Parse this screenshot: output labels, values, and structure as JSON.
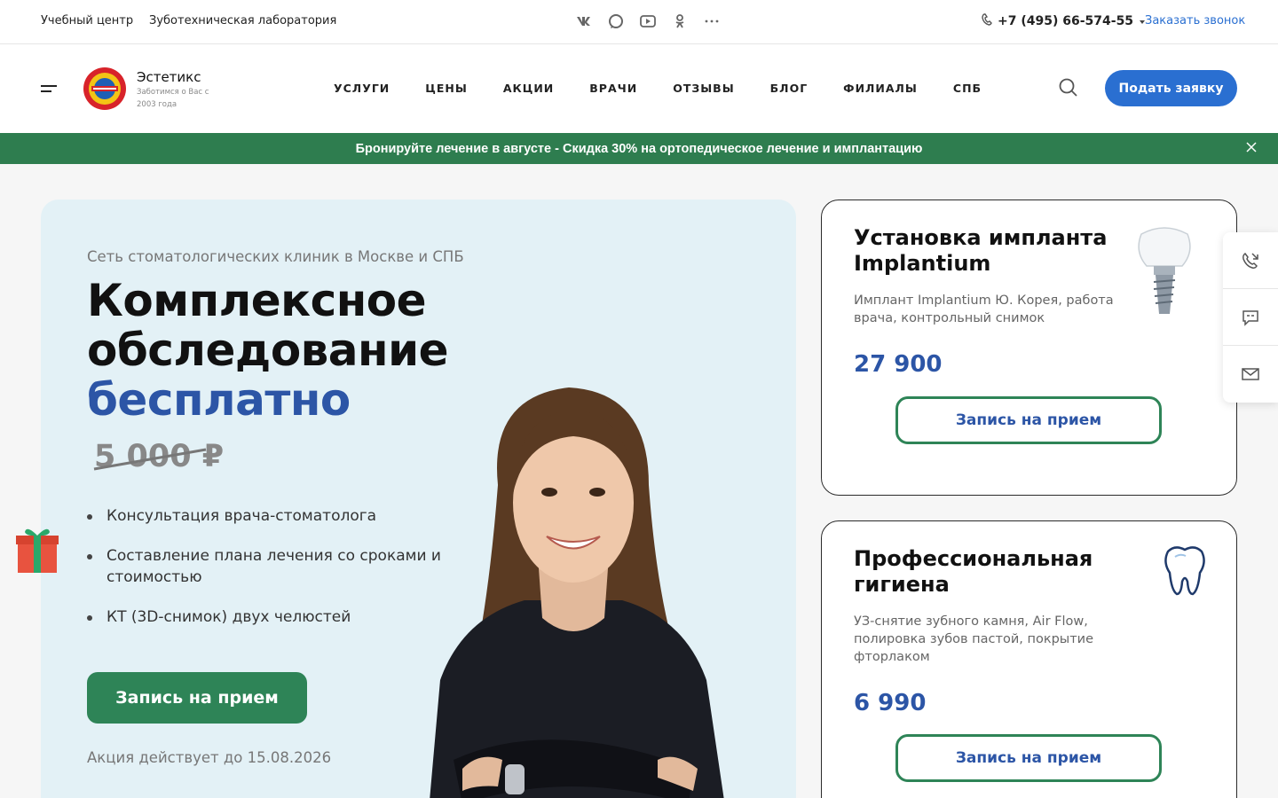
{
  "topbar": {
    "link_training": "Учебный центр",
    "link_lab": "Зуботехническая лаборатория",
    "socials": [
      "vk-icon",
      "chat-icon",
      "youtube-icon",
      "odnoklassniki-icon",
      "more-icon"
    ],
    "phone": "+7 (495) 66-574-55",
    "callback": "Заказать звонок"
  },
  "header": {
    "brand": "Эстетикс",
    "tagline": "Заботимся о Вас с 2003 года",
    "nav": [
      "УСЛУГИ",
      "ЦЕНЫ",
      "АКЦИИ",
      "ВРАЧИ",
      "ОТЗЫВЫ",
      "БЛОГ",
      "ФИЛИАЛЫ",
      "СПБ"
    ],
    "apply_label": "Подать заявку"
  },
  "promo": {
    "text": "Бронируйте лечение в августе - Скидка 30% на ортопедическое лечение и имплантацию",
    "color": "#2e7d4f"
  },
  "hero": {
    "subtitle": "Сеть стоматологических клиник в Москве и СПБ",
    "title_line1": "Комплексное",
    "title_line2": "обследование",
    "title_accent": "бесплатно",
    "old_price": "5 000 ₽",
    "bullets": [
      "Консультация врача-стоматолога",
      "Составление плана лечения со сроками и стоимостью",
      "КТ (3D-снимок) двух челюстей"
    ],
    "cta_label": "Запись на прием",
    "note": "Акция действует до 15.08.2026"
  },
  "cards": [
    {
      "title": "Установка импланта Implantium",
      "description": "Имплант Implantium Ю. Корея, работа врача, контрольный снимок",
      "price": "27 900",
      "button": "Запись на прием",
      "icon": "implant-icon"
    },
    {
      "title": "Профессиональная гигиена",
      "description": "УЗ-снятие зубного камня, Air Flow, полировка зубов пастой, покрытие фторлаком",
      "price": "6 990",
      "button": "Запись на прием",
      "icon": "tooth-icon"
    }
  ],
  "side_widget": [
    "phone-call-icon",
    "chat-bubble-icon",
    "mail-icon"
  ],
  "colors": {
    "primary_blue": "#2a6fd1",
    "accent_blue": "#2c55a6",
    "green": "#2e8457",
    "hero_bg": "#e3f1f6"
  }
}
